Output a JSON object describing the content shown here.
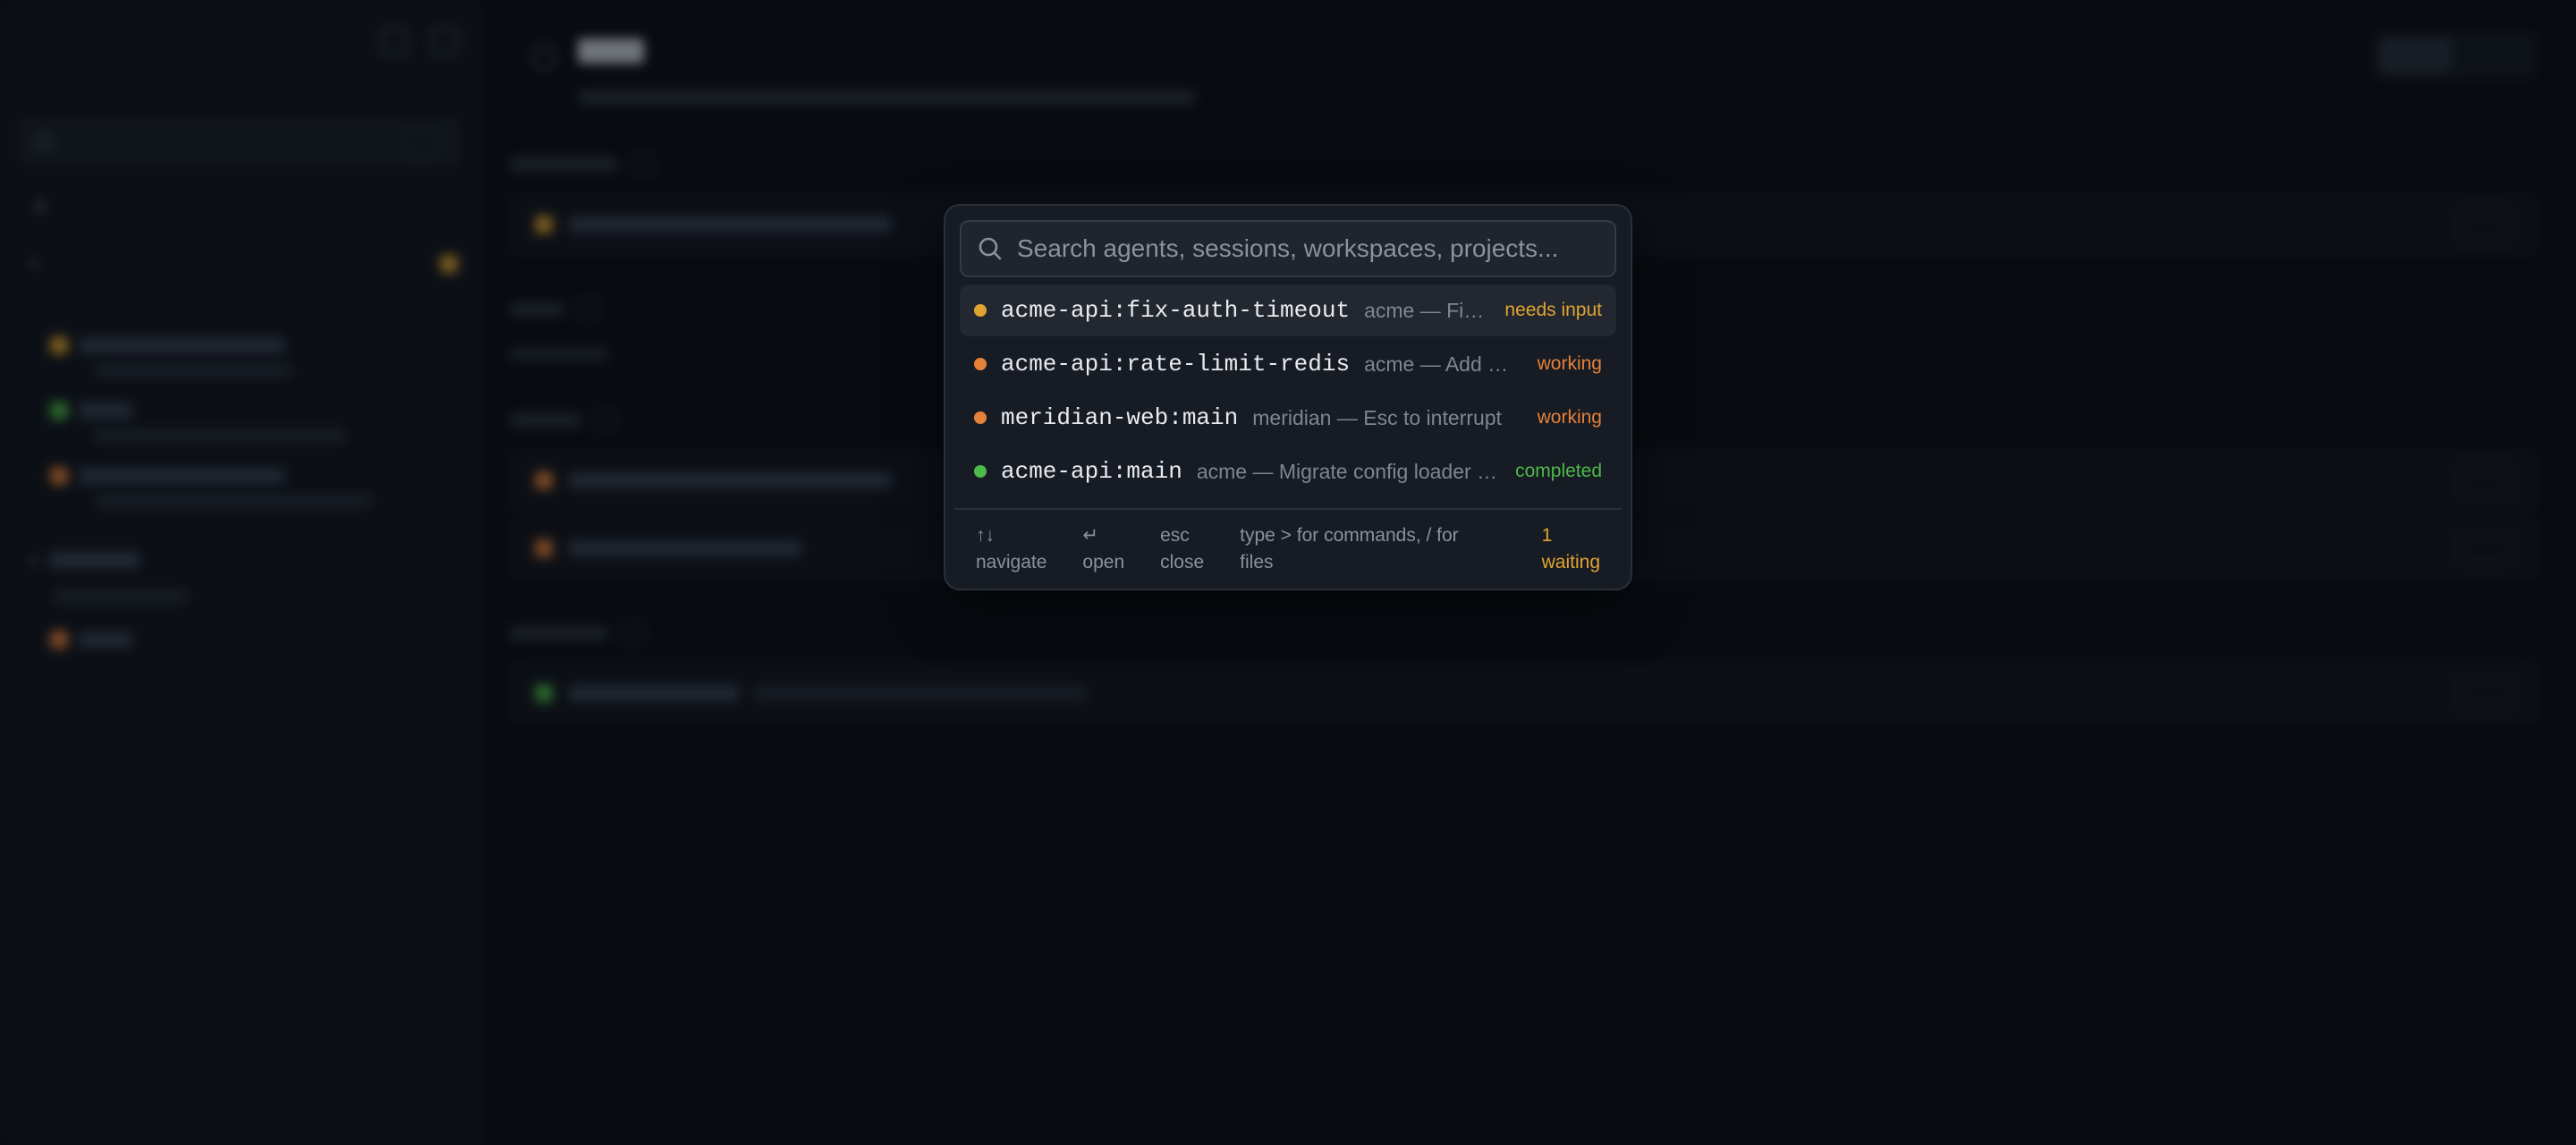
{
  "colors": {
    "needs_input": "#e0a431",
    "working": "#e6813a",
    "completed": "#4cba4a",
    "waiting": "#e0a431"
  },
  "palette": {
    "search_placeholder": "Search agents, sessions, workspaces, projects...",
    "items": [
      {
        "name": "acme-api:fix-auth-timeout",
        "desc": "acme — Fix auth timeout",
        "status": "needs input",
        "status_key": "needs_input"
      },
      {
        "name": "acme-api:rate-limit-redis",
        "desc": "acme — Add Redis rate limiter",
        "status": "working",
        "status_key": "working"
      },
      {
        "name": "meridian-web:main",
        "desc": "meridian — Esc to interrupt",
        "status": "working",
        "status_key": "working"
      },
      {
        "name": "acme-api:main",
        "desc": "acme — Migrate config loader to yaml",
        "status": "completed",
        "status_key": "completed"
      }
    ],
    "footer": {
      "navigate_key": "↑↓",
      "navigate_label": "navigate",
      "open_key": "↵",
      "open_label": "open",
      "close_key": "esc",
      "close_label": "close",
      "hint_line1": "type > for commands, / for",
      "hint_line2": "files",
      "waiting_count": "1",
      "waiting_label": "waiting"
    }
  }
}
